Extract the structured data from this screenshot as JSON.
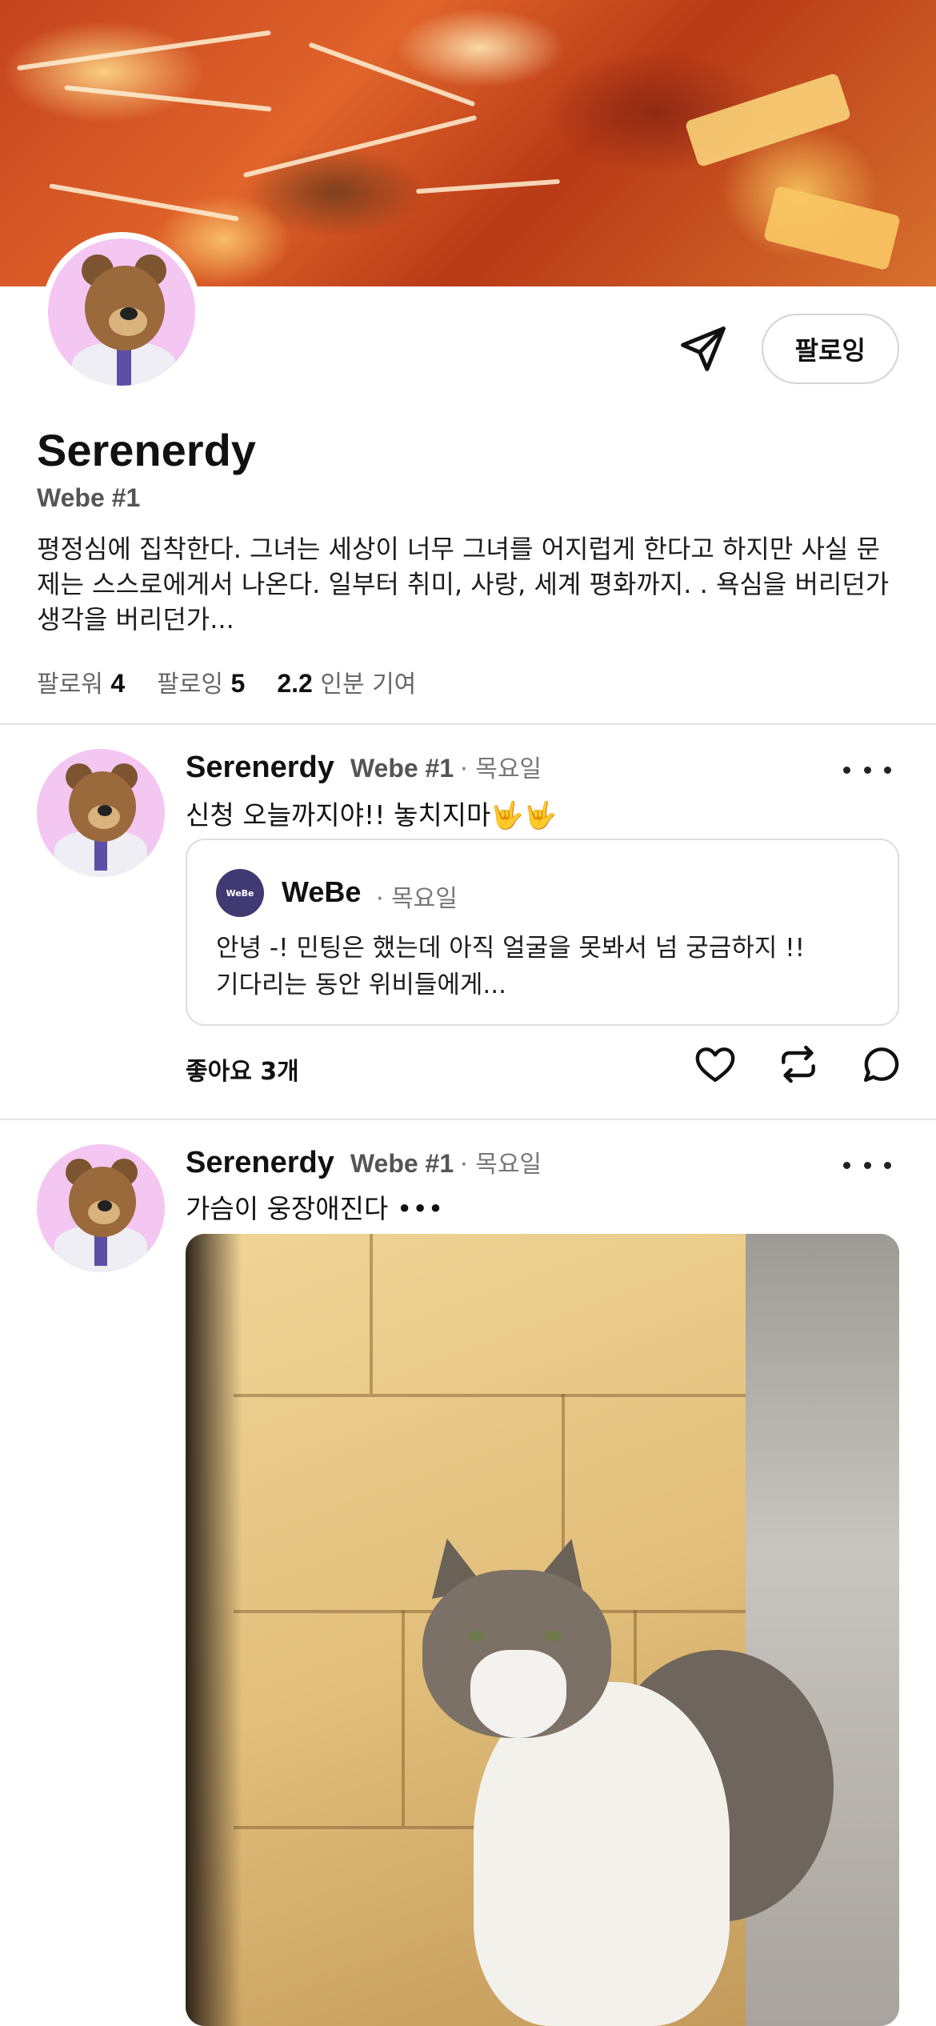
{
  "profile": {
    "name": "Serenerdy",
    "handle": "Webe #1",
    "bio": "평정심에 집착한다. 그녀는 세상이 너무 그녀를 어지럽게 한다고 하지만 사실 문제는 스스로에게서 나온다. 일부터 취미, 사랑, 세계 평화까지. . 욕심을 버리던가 생각을 버리던가...",
    "follow_button": "팔로잉",
    "stats": {
      "followers_label": "팔로워",
      "followers_count": "4",
      "following_label": "팔로잉",
      "following_count": "5",
      "contribution_value": "2.2",
      "contribution_label": "인분 기여"
    }
  },
  "posts": [
    {
      "author": "Serenerdy",
      "handle": "Webe #1",
      "time": "· 목요일",
      "text": "신청 오늘까지야!! 놓치지마🤟🤟",
      "quote": {
        "avatar_text": "WeBe",
        "author": "WeBe",
        "time": "· 목요일",
        "text": "안녕 -! 민팅은 했는데 아직 얼굴을 못봐서 넘 궁금하지 !!\n 기다리는 동안 위비들에게..."
      },
      "likes": "좋아요 3개"
    },
    {
      "author": "Serenerdy",
      "handle": "Webe #1",
      "time": "· 목요일",
      "text": "가슴이 웅장애진다 •••"
    }
  ],
  "icons": {
    "send": "paper-plane-icon",
    "more": "more-dots-icon",
    "like": "heart-icon",
    "repost": "repost-icon",
    "comment": "comment-icon"
  },
  "colors": {
    "avatar_bg": "#f4c6f2",
    "divider": "#e4e4e4",
    "muted_text": "#777777"
  }
}
